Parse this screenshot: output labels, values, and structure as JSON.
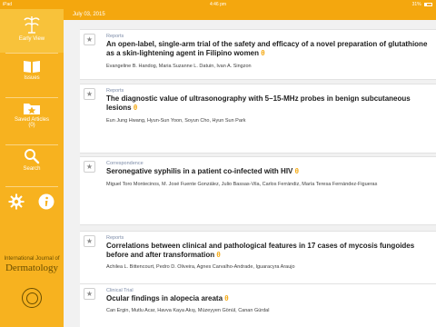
{
  "status_bar": {
    "device": "iPad",
    "time": "4:46 pm",
    "battery": "31%"
  },
  "sidebar": {
    "items": [
      {
        "label": "Early View",
        "icon": "early-view-icon"
      },
      {
        "label": "Issues",
        "icon": "book-icon"
      },
      {
        "label": "Saved Articles",
        "count": "(0)",
        "icon": "star-folder-icon"
      },
      {
        "label": "Search",
        "icon": "search-icon"
      }
    ],
    "settings_icon": "gear-icon",
    "info_icon": "info-icon",
    "journal": {
      "line1": "International Journal of",
      "line2": "Dermatology"
    }
  },
  "date_header": "July 03, 2015",
  "articles": [
    {
      "type": "Reports",
      "title": "An open-label, single-arm trial of the safety and efficacy of a novel preparation of glutathione as a skin-lightening agent in Filipino women",
      "authors": "Evangeline B. Handog, Maria Suzanne L. Datuin, Ivan A. Singzon"
    },
    {
      "type": "Reports",
      "title": "The diagnostic value of ultrasonography with 5–15-MHz probes in benign subcutaneous lesions",
      "authors": "Eun Jung Hwang, Hyun-Sun Yoon, Soyun Cho, Hyun Sun Park"
    },
    {
      "type": "Correspondence",
      "title": "Seronegative syphilis in a patient co-infected with HIV",
      "authors": "Miguel Toro Montecinos, M. José Fuente González, Julio Bassas-Vila, Carlos Ferrándiz, María Teresa Fernández-Figueras"
    },
    {
      "type": "Reports",
      "title": "Correlations between clinical and pathological features in 17 cases of mycosis fungoides before and after transformation",
      "authors": "Achilea L. Bittencourt, Pedro D. Oliveira, Agnes Carvalho-Andrade, Iguaracyra Araujo"
    },
    {
      "type": "Clinical Trial",
      "title": "Ocular findings in alopecia areata",
      "authors": "Can Ergin, Mutlu Acar, Havva Kaya Akış, Müzeyyen Gönül, Canan Gürdal"
    }
  ],
  "colors": {
    "accent": "#f4a70e",
    "sidebar": "#f7b21f",
    "journal_text": "#6a4e00",
    "type_label": "#7d8ca8"
  }
}
